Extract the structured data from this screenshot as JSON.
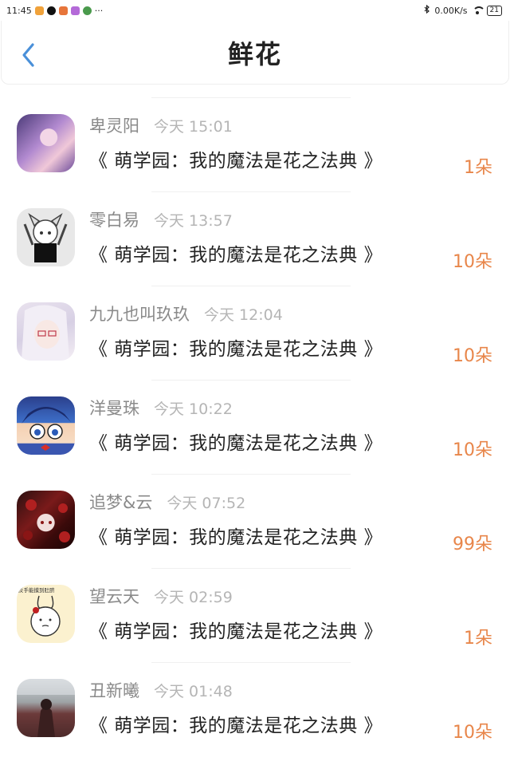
{
  "status_bar": {
    "time": "11:45",
    "more": "···",
    "network_speed": "0.00K/s",
    "battery": "21"
  },
  "header": {
    "title": "鲜花"
  },
  "items": [
    {
      "name": "卑灵阳",
      "time": "今天 15:01",
      "book": "《 萌学园：我的魔法是花之法典 》",
      "count": "1朵"
    },
    {
      "name": "零白易",
      "time": "今天 13:57",
      "book": "《 萌学园：我的魔法是花之法典 》",
      "count": "10朵"
    },
    {
      "name": "九九也叫玖玖",
      "time": "今天 12:04",
      "book": "《 萌学园：我的魔法是花之法典 》",
      "count": "10朵"
    },
    {
      "name": "洋曼珠",
      "time": "今天 10:22",
      "book": "《 萌学园：我的魔法是花之法典 》",
      "count": "10朵"
    },
    {
      "name": "追梦&云",
      "time": "今天 07:52",
      "book": "《 萌学园：我的魔法是花之法典 》",
      "count": "99朵"
    },
    {
      "name": "望云天",
      "time": "今天 02:59",
      "book": "《 萌学园：我的魔法是花之法典 》",
      "count": "1朵"
    },
    {
      "name": "丑新曦",
      "time": "今天 01:48",
      "book": "《 萌学园：我的魔法是花之法典 》",
      "count": "10朵"
    }
  ],
  "avatar_text": {
    "item_6": "反手能摸到肚脐"
  },
  "colors": {
    "accent_back": "#4a90d9",
    "count_orange": "#e8864a",
    "name_gray": "#8a8a8a",
    "time_gray": "#b5b5b5"
  },
  "icons": {
    "back": "chevron-left-icon",
    "wifi": "wifi-icon",
    "bluetooth": "bluetooth-icon",
    "battery": "battery-icon"
  }
}
